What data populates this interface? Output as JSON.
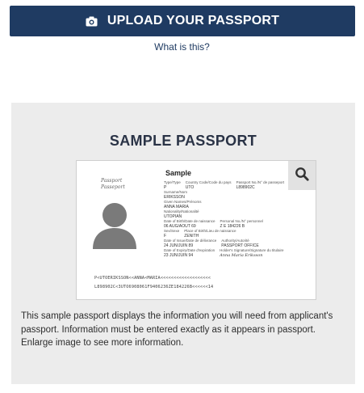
{
  "upload": {
    "label": "UPLOAD YOUR PASSPORT",
    "icon": "camera-icon"
  },
  "help_link": "What is this?",
  "sample": {
    "title": "SAMPLE PASSPORT",
    "zoom_icon": "magnifier-icon",
    "description": "This sample passport displays the information you will need from applicant's passport. Information must be entered exactly as it appears in passport. Enlarge image to see more information.",
    "passport": {
      "header_line1": "Passport",
      "header_line2": "Passeport",
      "sample_label": "Sample",
      "type_label": "Type/Type",
      "type_value": "P",
      "country_label": "Country Code/Code du pays",
      "country_value": "UTO",
      "passport_no_label": "Passport No./N° de passeport",
      "passport_no_value": "L898902C",
      "surname_label": "Surname/Nom",
      "surname_value": "ERIKSSON",
      "given_label": "Given Names/Prénoms",
      "given_value": "ANNA MARIA",
      "nationality_label": "Nationality/Nationalité",
      "nationality_value": "UTOPIAN",
      "dob_label": "Date of Birth/Date de naissance",
      "dob_value": "06 AUG/AOUT 69",
      "personal_no_label": "Personal No./N° personnel",
      "personal_no_value": "Z E 184226 B",
      "sex_label": "Sex/Sexe",
      "sex_value": "F",
      "pob_label": "Place of Birth/Lieu de naissance",
      "pob_value": "ZENITH",
      "doi_label": "Date of Issue/Date de délivrance",
      "doi_value": "24 JUN/JUIN 89",
      "authority_label": "Authority/Autorité",
      "authority_value": "PASSPORT OFFICE",
      "doe_label": "Date of Expiry/Date d'expiration",
      "doe_value": "23 JUN/JUIN 94",
      "signature_label": "Holder's Signature/Signature du titulaire",
      "signature_value": "Anna Maria Eriksson",
      "mrz_line1": "P<UTOERIKSSON<<ANNA<MARIA<<<<<<<<<<<<<<<<<<<",
      "mrz_line2": "L898902C<3UTO6908061F9406236ZE184226B<<<<<<14"
    }
  }
}
